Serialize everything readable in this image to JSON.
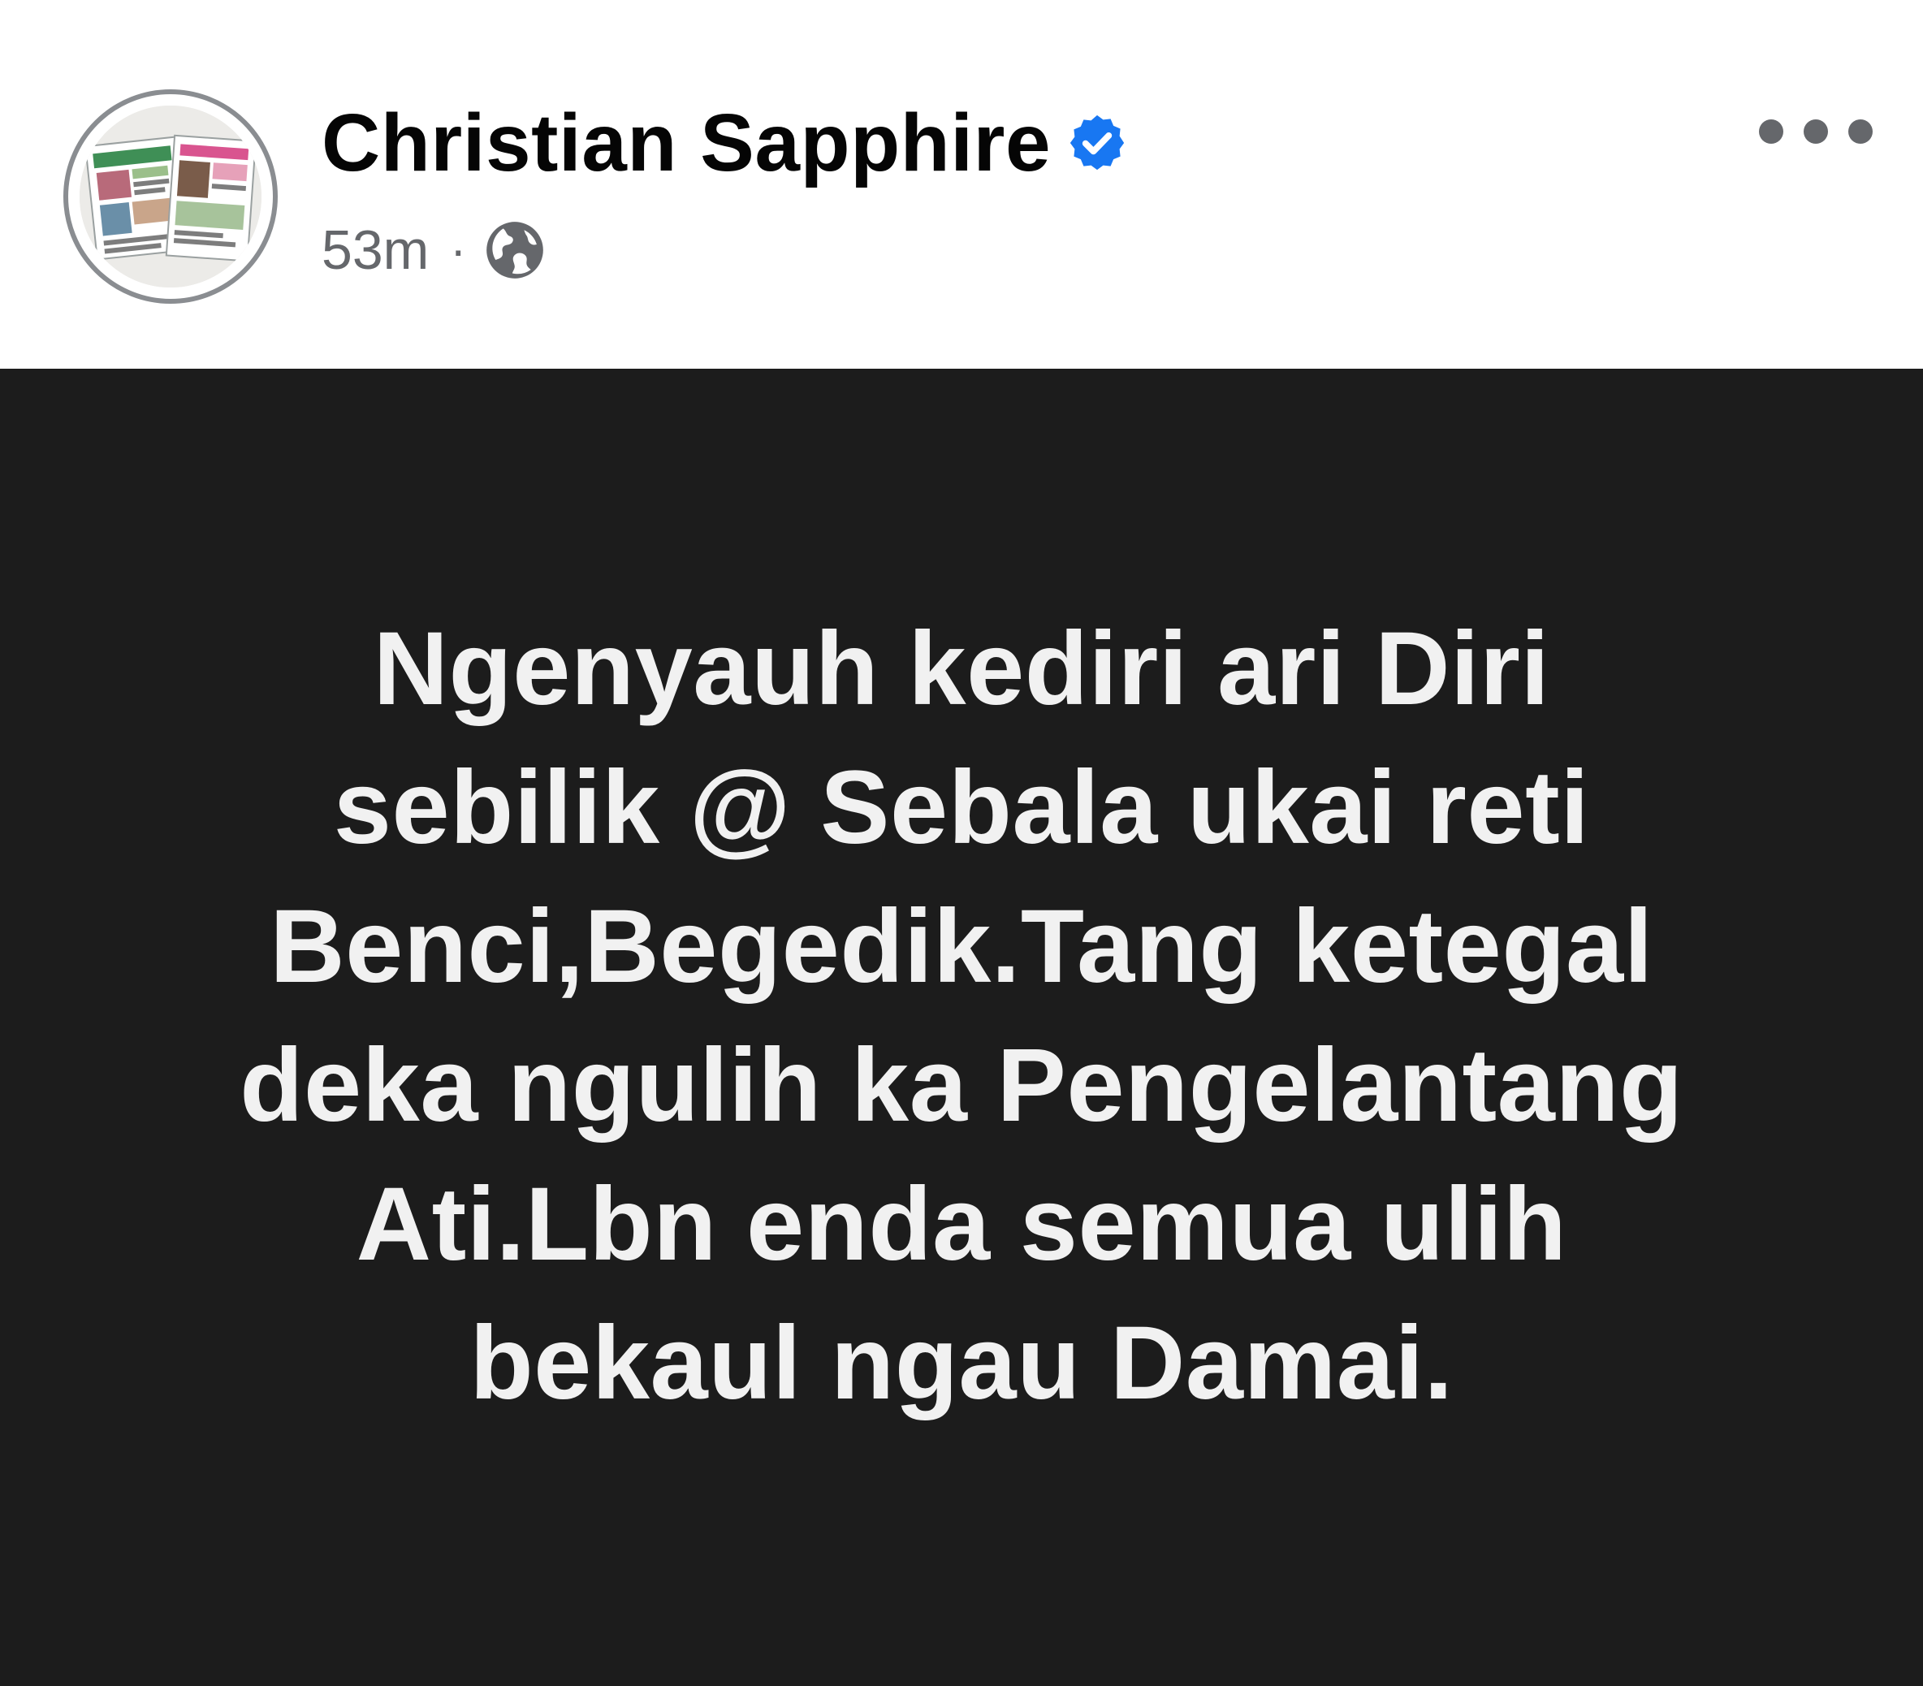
{
  "post": {
    "author": {
      "name": "Christian Sapphire",
      "verified": true,
      "verified_icon": "verified-badge-icon",
      "avatar_icon": "avatar-newspaper-collage"
    },
    "meta": {
      "timestamp": "53m",
      "separator": "·",
      "audience_icon": "globe-icon"
    },
    "more_icon": "more-options-icon",
    "body": {
      "background_color": "#1c1c1c",
      "text_color": "#f1f1f1",
      "lines": [
        "Ngenyauh kediri ari Diri",
        "sebilik @ Sebala ukai reti",
        "Benci,Begedik.Tang ketegal",
        "deka ngulih ka Pengelantang",
        "Ati.Lbn enda semua ulih",
        "bekaul ngau Damai."
      ]
    },
    "colors": {
      "verified_blue": "#1877f2",
      "secondary_text": "#65676b"
    }
  }
}
